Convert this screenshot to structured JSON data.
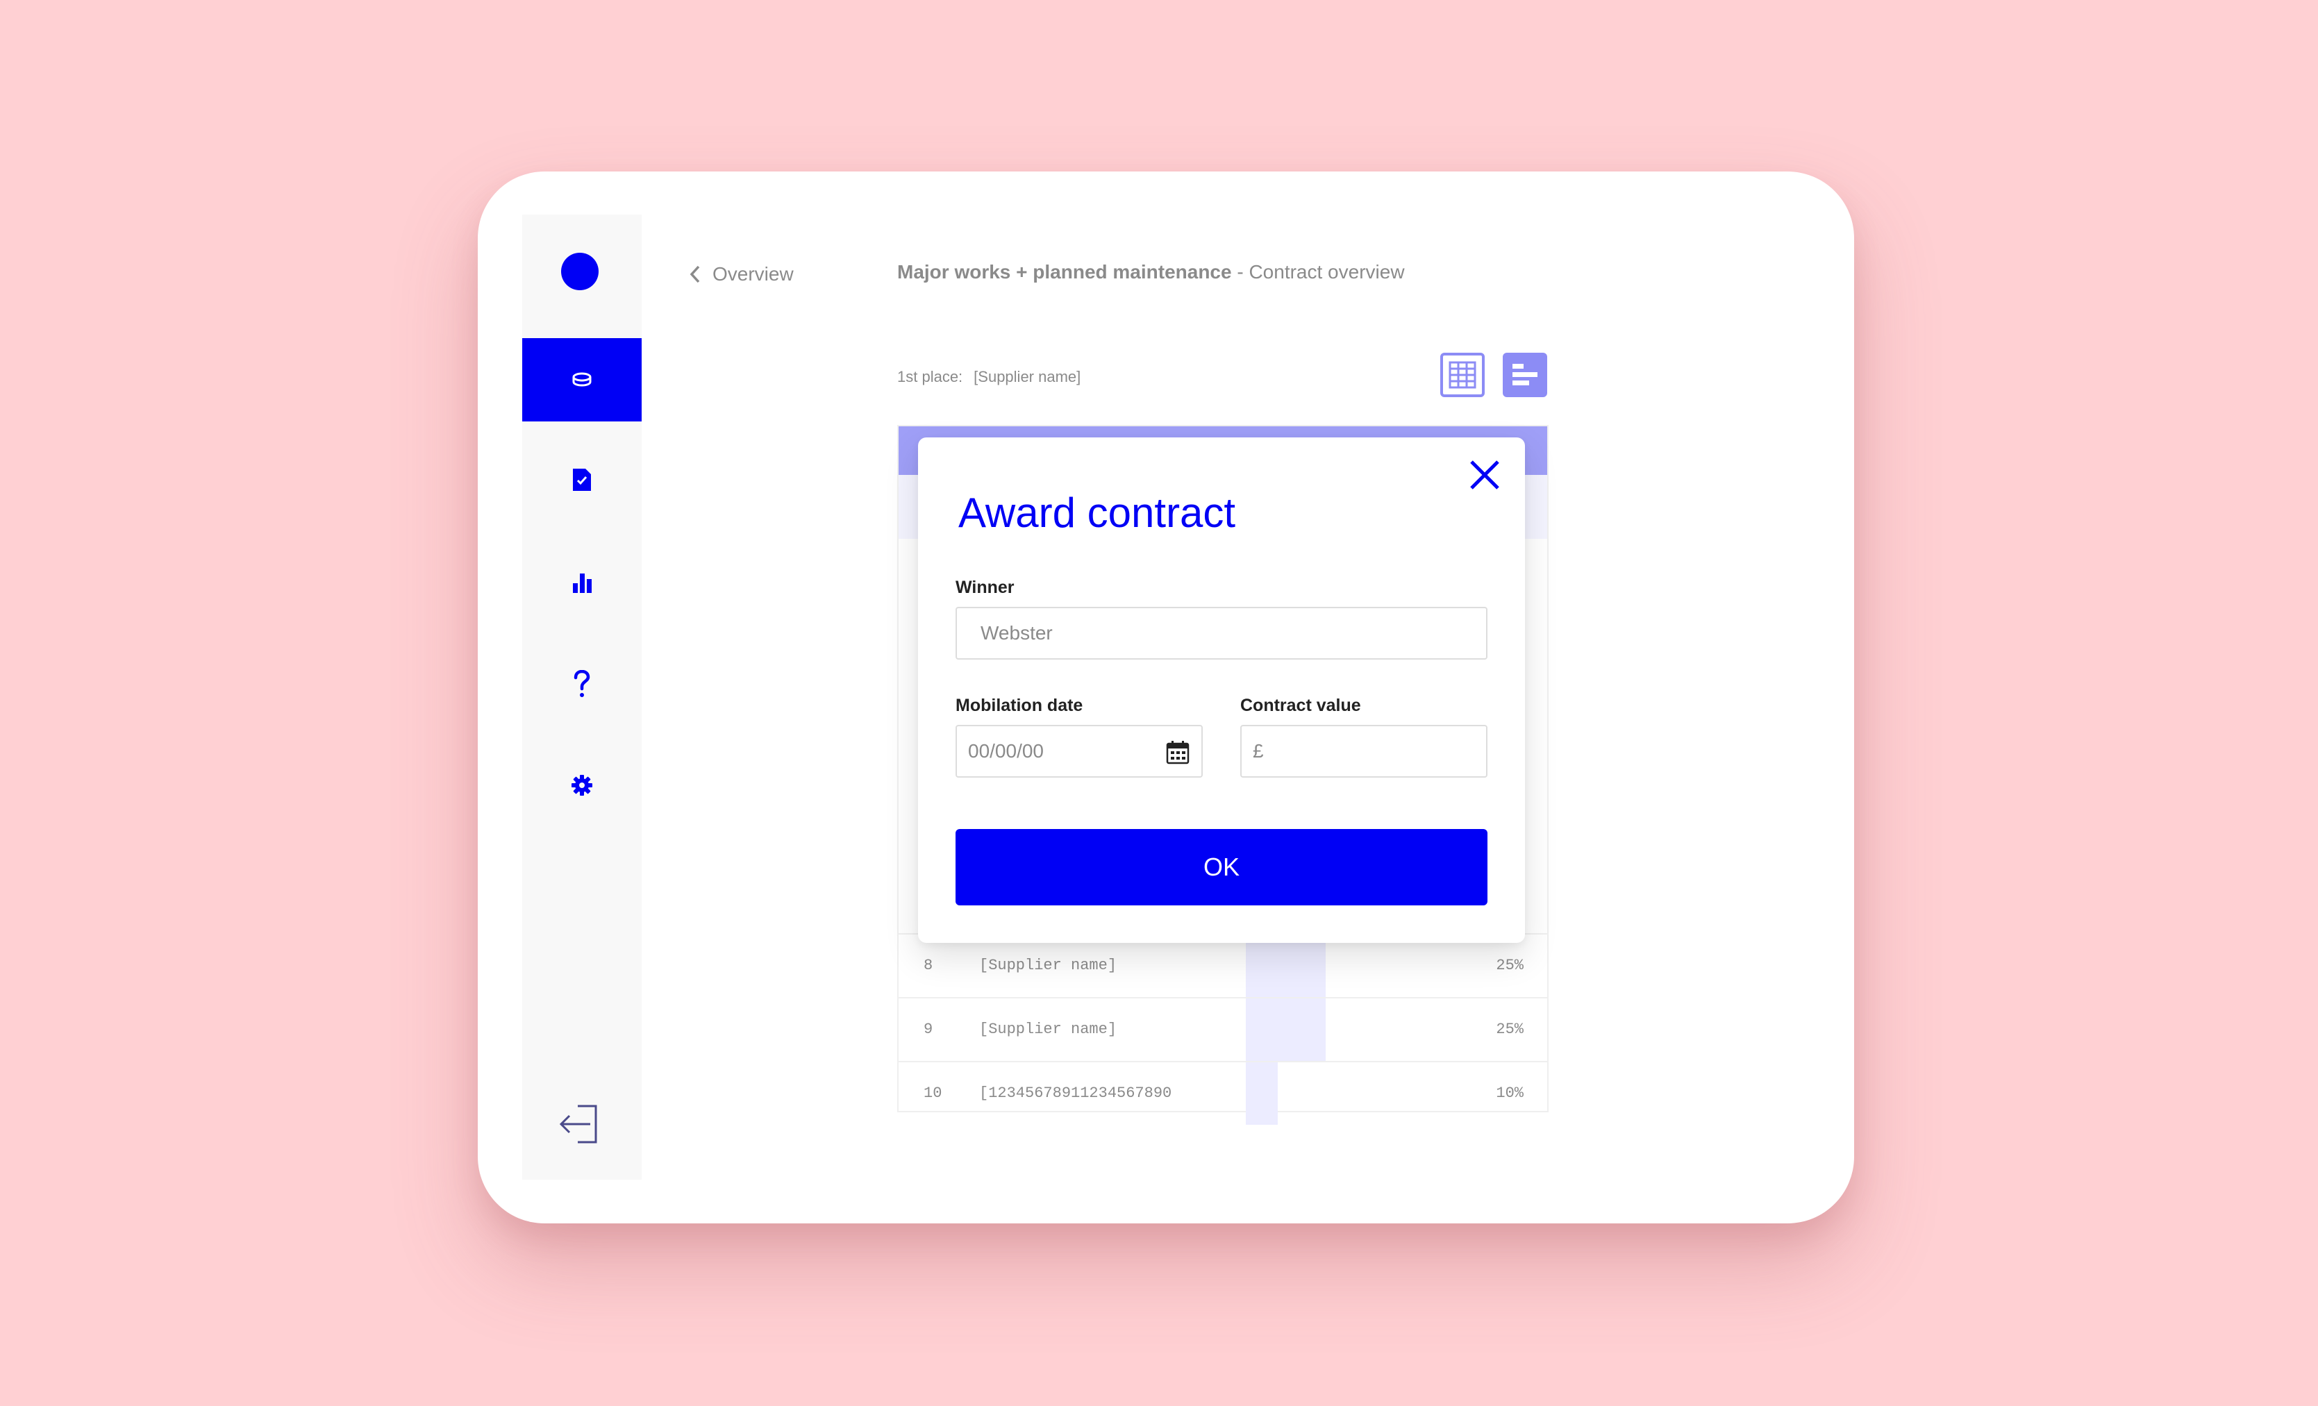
{
  "nav": {
    "items": [
      {
        "icon": "coins-icon",
        "active": true
      },
      {
        "icon": "document-check-icon",
        "active": false
      },
      {
        "icon": "bar-chart-icon",
        "active": false
      },
      {
        "icon": "question-icon",
        "active": false
      },
      {
        "icon": "gear-icon",
        "active": false
      }
    ],
    "logout_icon": "logout-icon"
  },
  "header": {
    "back_label": "Overview",
    "title_bold": "Major works + planned maintenance",
    "title_rest": " - Contract overview"
  },
  "summary": {
    "first_place_label": "1st place:",
    "first_place_value": "[Supplier name]"
  },
  "view_toggle": {
    "grid_icon": "grid-view-icon",
    "bars_icon": "bar-view-icon"
  },
  "table": {
    "rows": [
      {
        "rank": "8",
        "name": "[Supplier name]",
        "pct": "25%",
        "share": 0.25
      },
      {
        "rank": "9",
        "name": "[Supplier name]",
        "pct": "25%",
        "share": 0.25
      },
      {
        "rank": "10",
        "name": "[12345678911234567890",
        "pct": "10%",
        "share": 0.1
      }
    ]
  },
  "modal": {
    "title": "Award contract",
    "winner_label": "Winner",
    "winner_value": "Webster",
    "mobilisation_label": "Mobilation date",
    "mobilisation_value": "00/00/00",
    "contract_value_label": "Contract value",
    "contract_value_prefix": "£",
    "ok_label": "OK"
  },
  "colors": {
    "accent": "#0000f5",
    "lavender": "#8c8cf5",
    "background": "#ffd0d3"
  }
}
